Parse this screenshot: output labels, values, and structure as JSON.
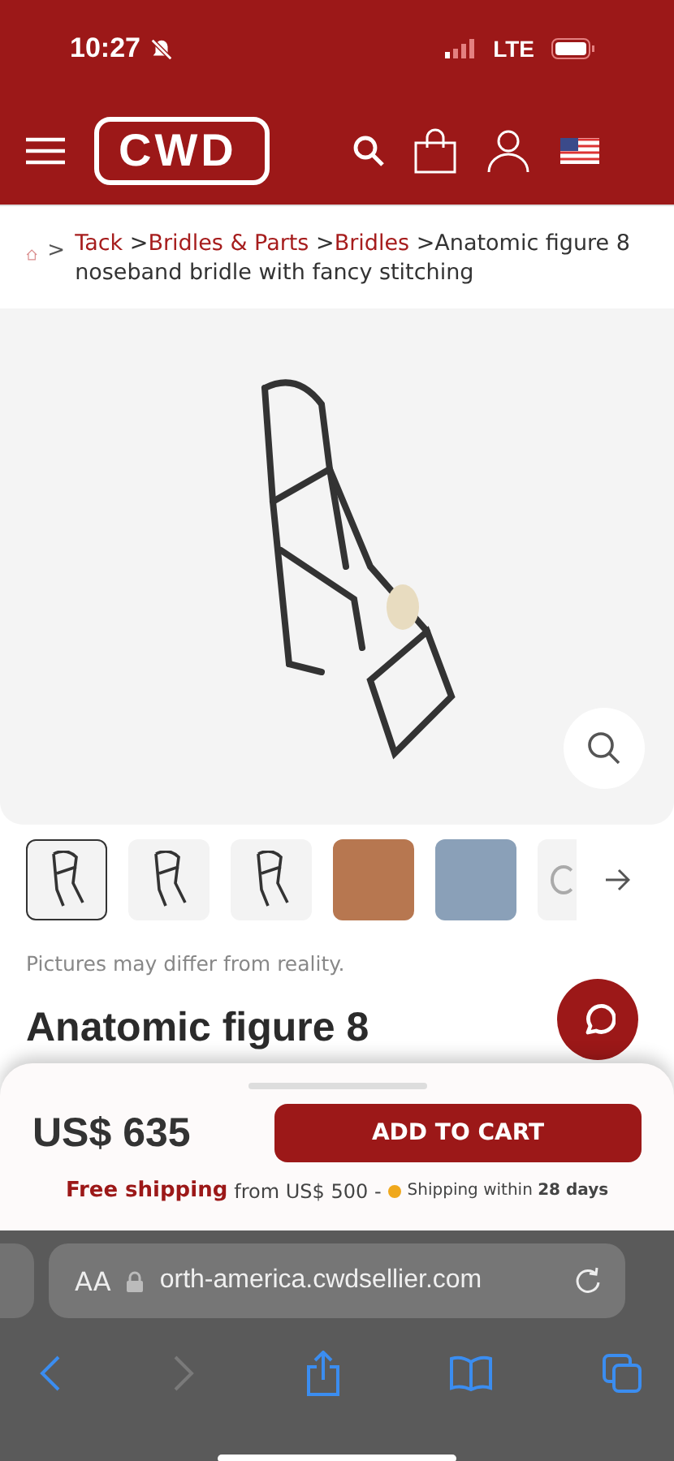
{
  "status_bar": {
    "time": "10:27",
    "network": "LTE"
  },
  "header": {
    "logo": "CWD"
  },
  "breadcrumb": {
    "separator": ">",
    "links": [
      "Tack",
      "Bridles & Parts",
      "Bridles"
    ],
    "current": "Anatomic figure 8 noseband bridle with fancy stitching"
  },
  "gallery": {
    "thumbnails": [
      {
        "kind": "drawing",
        "selected": true
      },
      {
        "kind": "drawing",
        "selected": false
      },
      {
        "kind": "drawing",
        "selected": false
      },
      {
        "kind": "photo",
        "selected": false
      },
      {
        "kind": "photo",
        "selected": false
      },
      {
        "kind": "partial",
        "selected": false
      }
    ],
    "caption": "Pictures may differ from reality."
  },
  "product": {
    "title": "Anatomic figure 8"
  },
  "buy_bar": {
    "price": "US$ 635",
    "button": "ADD TO CART",
    "free_shipping": "Free shipping",
    "shipping_from": "from US$ 500 -",
    "availability": "Shipping within **28 days**"
  },
  "browser": {
    "text_size": "AA",
    "url": "orth-america.cwdsellier.com",
    "back_disabled": false,
    "forward_disabled": true
  }
}
